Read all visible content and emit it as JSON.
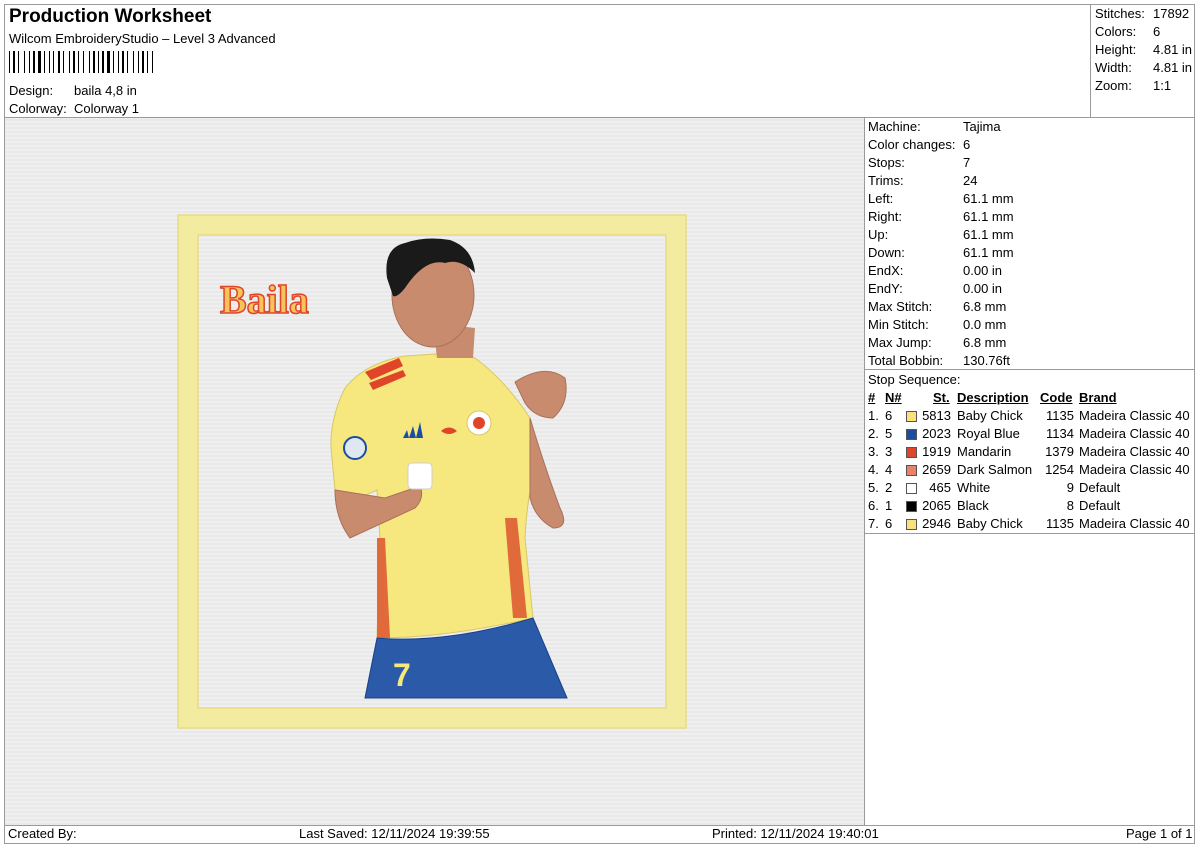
{
  "header": {
    "title": "Production Worksheet",
    "software": "Wilcom EmbroideryStudio – Level 3 Advanced",
    "design_label": "Design:",
    "design_value": "baila 4,8 in",
    "colorway_label": "Colorway:",
    "colorway_value": "Colorway 1"
  },
  "summary": [
    {
      "label": "Stitches:",
      "value": "17892"
    },
    {
      "label": "Colors:",
      "value": "6"
    },
    {
      "label": "Height:",
      "value": "4.81 in"
    },
    {
      "label": "Width:",
      "value": "4.81 in"
    },
    {
      "label": "Zoom:",
      "value": "1:1"
    }
  ],
  "machine_info": [
    {
      "label": "Machine:",
      "value": "Tajima"
    },
    {
      "label": "Color changes:",
      "value": "6"
    },
    {
      "label": "Stops:",
      "value": "7"
    },
    {
      "label": "Trims:",
      "value": "24"
    },
    {
      "label": "Left:",
      "value": "61.1 mm"
    },
    {
      "label": "Right:",
      "value": "61.1 mm"
    },
    {
      "label": "Up:",
      "value": "61.1 mm"
    },
    {
      "label": "Down:",
      "value": "61.1 mm"
    },
    {
      "label": "EndX:",
      "value": "0.00 in"
    },
    {
      "label": "EndY:",
      "value": "0.00 in"
    },
    {
      "label": "Max Stitch:",
      "value": "6.8 mm"
    },
    {
      "label": "Min Stitch:",
      "value": "0.0 mm"
    },
    {
      "label": "Max Jump:",
      "value": "6.8 mm"
    },
    {
      "label": "Total Bobbin:",
      "value": "130.76ft"
    }
  ],
  "stop_sequence": {
    "title": "Stop Sequence:",
    "headers": {
      "num": "#",
      "n": "N#",
      "st": "St.",
      "desc": "Description",
      "code": "Code",
      "brand": "Brand"
    },
    "rows": [
      {
        "num": "1.",
        "n": "6",
        "color": "#f9e27a",
        "st": "5813",
        "desc": "Baby Chick",
        "code": "1135",
        "brand": "Madeira Classic 40"
      },
      {
        "num": "2.",
        "n": "5",
        "color": "#1a4fa0",
        "st": "2023",
        "desc": "Royal Blue",
        "code": "1134",
        "brand": "Madeira Classic 40"
      },
      {
        "num": "3.",
        "n": "3",
        "color": "#e0452a",
        "st": "1919",
        "desc": "Mandarin",
        "code": "1379",
        "brand": "Madeira Classic 40"
      },
      {
        "num": "4.",
        "n": "4",
        "color": "#e8836a",
        "st": "2659",
        "desc": "Dark Salmon",
        "code": "1254",
        "brand": "Madeira Classic 40"
      },
      {
        "num": "5.",
        "n": "2",
        "color": "#ffffff",
        "st": "465",
        "desc": "White",
        "code": "9",
        "brand": "Default"
      },
      {
        "num": "6.",
        "n": "1",
        "color": "#000000",
        "st": "2065",
        "desc": "Black",
        "code": "8",
        "brand": "Default"
      },
      {
        "num": "7.",
        "n": "6",
        "color": "#f9e27a",
        "st": "2946",
        "desc": "Baby Chick",
        "code": "1135",
        "brand": "Madeira Classic 40"
      }
    ]
  },
  "design": {
    "text": "Baila",
    "jersey_number": "7"
  },
  "footer": {
    "created_by": "Created By:",
    "last_saved": "Last Saved: 12/11/2024 19:39:55",
    "printed": "Printed: 12/11/2024 19:40:01",
    "page": "Page 1 of 1"
  }
}
